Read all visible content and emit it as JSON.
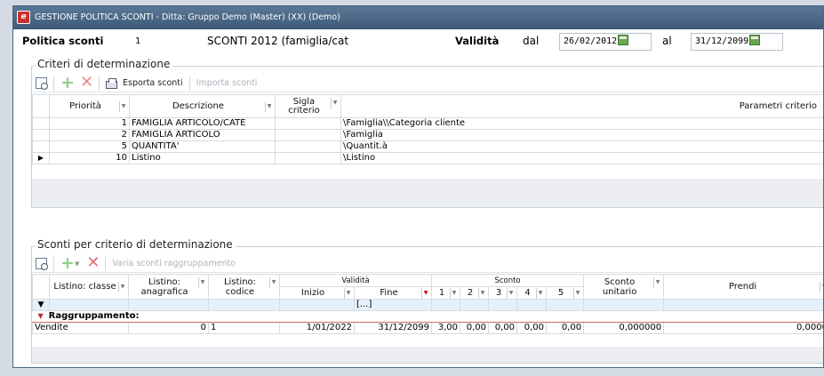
{
  "window": {
    "title": "GESTIONE POLITICA SCONTI - Ditta: Gruppo Demo (Master) (XX)  (Demo)"
  },
  "header": {
    "policy_label": "Politica sconti",
    "policy_code": "1",
    "policy_desc": "SCONTI 2012 (famiglia/cat",
    "validity_label": "Validità",
    "from_label": "dal",
    "from_date": "26/02/2012",
    "to_label": "al",
    "to_date": "31/12/2099"
  },
  "criteria": {
    "group_title": "Criteri di determinazione",
    "toolbar": {
      "export": "Esporta sconti",
      "import": "Importa sconti"
    },
    "columns": {
      "priority": "Priorità",
      "description": "Descrizione",
      "code": "Sigla criterio",
      "params": "Parametri criterio"
    },
    "rows": [
      {
        "priority": "1",
        "description": "FAMIGLIA ARTICOLO/CATE",
        "code": "",
        "params": "\\Famiglia\\\\Categoria cliente",
        "current": false
      },
      {
        "priority": "2",
        "description": "FAMIGLIA ARTICOLO",
        "code": "",
        "params": "\\Famiglia",
        "current": false
      },
      {
        "priority": "5",
        "description": "QUANTITA'",
        "code": "",
        "params": "\\Quantit.à",
        "current": false
      },
      {
        "priority": "10",
        "description": "Listino",
        "code": "",
        "params": "\\Listino",
        "current": true
      }
    ]
  },
  "discounts": {
    "group_title": "Sconti per criterio di determinazione",
    "toolbar": {
      "vary": "Varia sconti raggruppamento"
    },
    "columns": {
      "list_class": "Listino: classe",
      "list_registry": "Listino: anagrafica",
      "list_code": "Listino: codice",
      "validity": "Validità",
      "start": "Inizio",
      "end": "Fine",
      "discount": "Sconto",
      "d1": "1",
      "d2": "2",
      "d3": "3",
      "d4": "4",
      "d5": "5",
      "unit_discount": "Sconto unitario",
      "take": "Prendi"
    },
    "filter_end": "[...]",
    "group_label": "Raggruppamento:",
    "rows": [
      {
        "list_class": "Vendite",
        "list_registry": "0",
        "list_code": "1",
        "start": "1/01/2022",
        "end": "31/12/2099",
        "d1": "3,00",
        "d2": "0,00",
        "d3": "0,00",
        "d4": "0,00",
        "d5": "0,00",
        "unit_discount": "0,000000",
        "take": "0,0000"
      }
    ]
  },
  "colors": {
    "titlebar": "#4a6886",
    "accent_red": "#c8322a",
    "filter_row": "#e4f0fb"
  }
}
